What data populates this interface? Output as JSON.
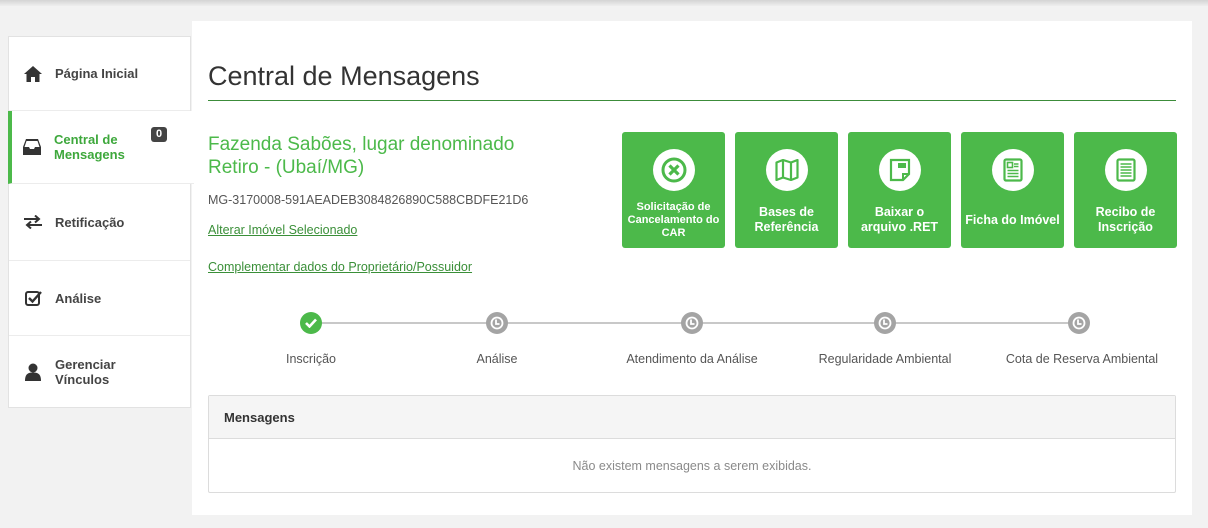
{
  "sidebar": {
    "items": [
      {
        "label": "Página Inicial",
        "icon": "home-icon"
      },
      {
        "label_line1": "Central de",
        "label_line2": "Mensagens",
        "icon": "inbox-icon",
        "badge": "0",
        "active": true
      },
      {
        "label": "Retificação",
        "icon": "exchange-arrows-icon"
      },
      {
        "label": "Análise",
        "icon": "check-square-icon"
      },
      {
        "label_line1": "Gerenciar",
        "label_line2": "Vínculos",
        "icon": "user-icon"
      }
    ]
  },
  "main": {
    "title": "Central de Mensagens",
    "farm_name_line1": "Fazenda Sabões, lugar denominado",
    "farm_name_line2": "Retiro - (Ubaí/MG)",
    "farm_code": "MG-3170008-591AEADEB3084826890C588CBDFE21D6",
    "link_change_property": "Alterar Imóvel Selecionado",
    "link_complement_owner": "Complementar dados do Proprietário/Possuidor",
    "actions": [
      {
        "label": "Solicitação de Cancelamento do CAR",
        "icon": "cancel-circle-icon"
      },
      {
        "label": "Bases de Referência",
        "icon": "map-icon"
      },
      {
        "label": "Baixar o arquivo .RET",
        "icon": "ret-file-icon"
      },
      {
        "label": "Ficha do Imóvel",
        "icon": "property-sheet-icon"
      },
      {
        "label": "Recibo de Inscrição",
        "icon": "receipt-icon"
      }
    ],
    "steps": [
      {
        "label": "Inscrição",
        "status": "done"
      },
      {
        "label": "Análise",
        "status": "pending"
      },
      {
        "label": "Atendimento da Análise",
        "status": "pending"
      },
      {
        "label": "Regularidade Ambiental",
        "status": "pending"
      },
      {
        "label": "Cota de Reserva Ambiental",
        "status": "pending"
      }
    ],
    "messages": {
      "header": "Mensagens",
      "empty_text": "Não existem mensagens a serem exibidas."
    }
  },
  "colors": {
    "accent": "#4cb94a",
    "link": "#3a8f38",
    "pending": "#a4a4a4"
  }
}
